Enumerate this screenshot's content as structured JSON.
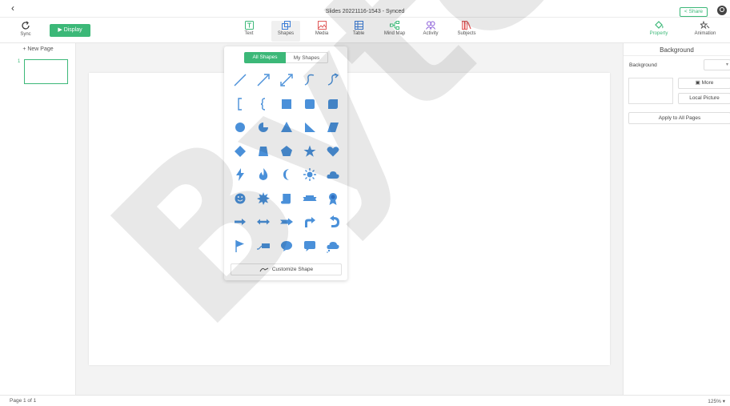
{
  "header": {
    "doc_title": "Slides 20221116-1543 - Synced",
    "share_label": "Share"
  },
  "toolbar": {
    "sync_label": "Sync",
    "display_label": "Display",
    "tools": [
      {
        "label": "Text",
        "icon": "text-icon"
      },
      {
        "label": "Shapes",
        "icon": "shapes-icon"
      },
      {
        "label": "Media",
        "icon": "media-icon"
      },
      {
        "label": "Table",
        "icon": "table-icon"
      },
      {
        "label": "Mind Map",
        "icon": "mind-map-icon"
      },
      {
        "label": "Activity",
        "icon": "activity-icon"
      },
      {
        "label": "Subjects",
        "icon": "subjects-icon"
      }
    ],
    "property_label": "Property",
    "animation_label": "Animation"
  },
  "left_panel": {
    "new_page_label": "+ New Page",
    "pages": [
      {
        "number": "1"
      }
    ]
  },
  "shapes_popup": {
    "tab_all": "All Shapes",
    "tab_mine": "My Shapes",
    "customize_label": "Customize Shape",
    "shapes": [
      "line",
      "arrow-line",
      "double-arrow-line",
      "curve",
      "curved-arrow",
      "bracket",
      "brace",
      "square",
      "rounded-square",
      "snipped-square",
      "circle",
      "pie",
      "triangle",
      "right-triangle",
      "parallelogram",
      "diamond",
      "trapezoid",
      "pentagon",
      "star",
      "heart",
      "lightning",
      "flame",
      "moon",
      "sun",
      "cloud",
      "smiley",
      "explosion",
      "scroll",
      "ribbon-banner",
      "award-ribbon",
      "right-arrow",
      "left-right-arrow",
      "notched-arrow",
      "bent-arrow",
      "u-turn-arrow",
      "flag",
      "callout-line",
      "speech-oval",
      "speech-rectangle",
      "speech-cloud"
    ],
    "accent": "#4a90d9"
  },
  "right_panel": {
    "title": "Background",
    "background_label": "Background",
    "more_label": "More",
    "local_picture_label": "Local Picture",
    "apply_label": "Apply to All Pages"
  },
  "status": {
    "page_info": "Page 1 of 1",
    "zoom": "125%"
  },
  "watermark": {
    "text": "ByteD"
  },
  "colors": {
    "accent_green": "#3cb878",
    "shape_blue": "#4a90d9"
  }
}
